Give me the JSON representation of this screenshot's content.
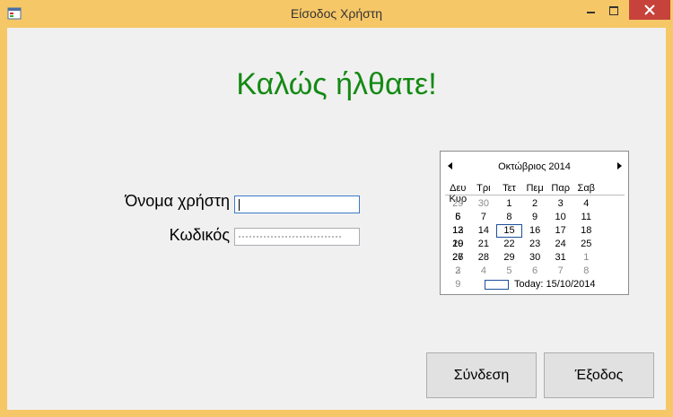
{
  "window": {
    "title": "Είσοδος Χρήστη",
    "icon": "form-icon",
    "controls": {
      "minimize": "minimize-icon",
      "maximize": "maximize-icon",
      "close": "close-icon"
    }
  },
  "welcome": "Καλώς ήλθατε!",
  "colors": {
    "welcome": "#148a14",
    "titlebar": "#f6c767",
    "close": "#c7423a"
  },
  "form": {
    "username_label": "Όνομα χρήστη",
    "username_value": "",
    "password_label": "Κωδικός",
    "password_value": "••••••••••••••••"
  },
  "calendar": {
    "month_title": "Οκτώβριος 2014",
    "weekdays": [
      "Δευ",
      "Τρι",
      "Τετ",
      "Πεμ",
      "Παρ",
      "Σαβ",
      "Κυρ"
    ],
    "weeks": [
      [
        "29",
        "30",
        "1",
        "2",
        "3",
        "4",
        "5"
      ],
      [
        "6",
        "7",
        "8",
        "9",
        "10",
        "11",
        "12"
      ],
      [
        "13",
        "14",
        "15",
        "16",
        "17",
        "18",
        "19"
      ],
      [
        "20",
        "21",
        "22",
        "23",
        "24",
        "25",
        "26"
      ],
      [
        "27",
        "28",
        "29",
        "30",
        "31",
        "1",
        "2"
      ],
      [
        "3",
        "4",
        "5",
        "6",
        "7",
        "8",
        "9"
      ]
    ],
    "selected": "15",
    "today_label": "Today: 15/10/2014"
  },
  "buttons": {
    "login": "Σύνδεση",
    "exit": "Έξοδος"
  }
}
